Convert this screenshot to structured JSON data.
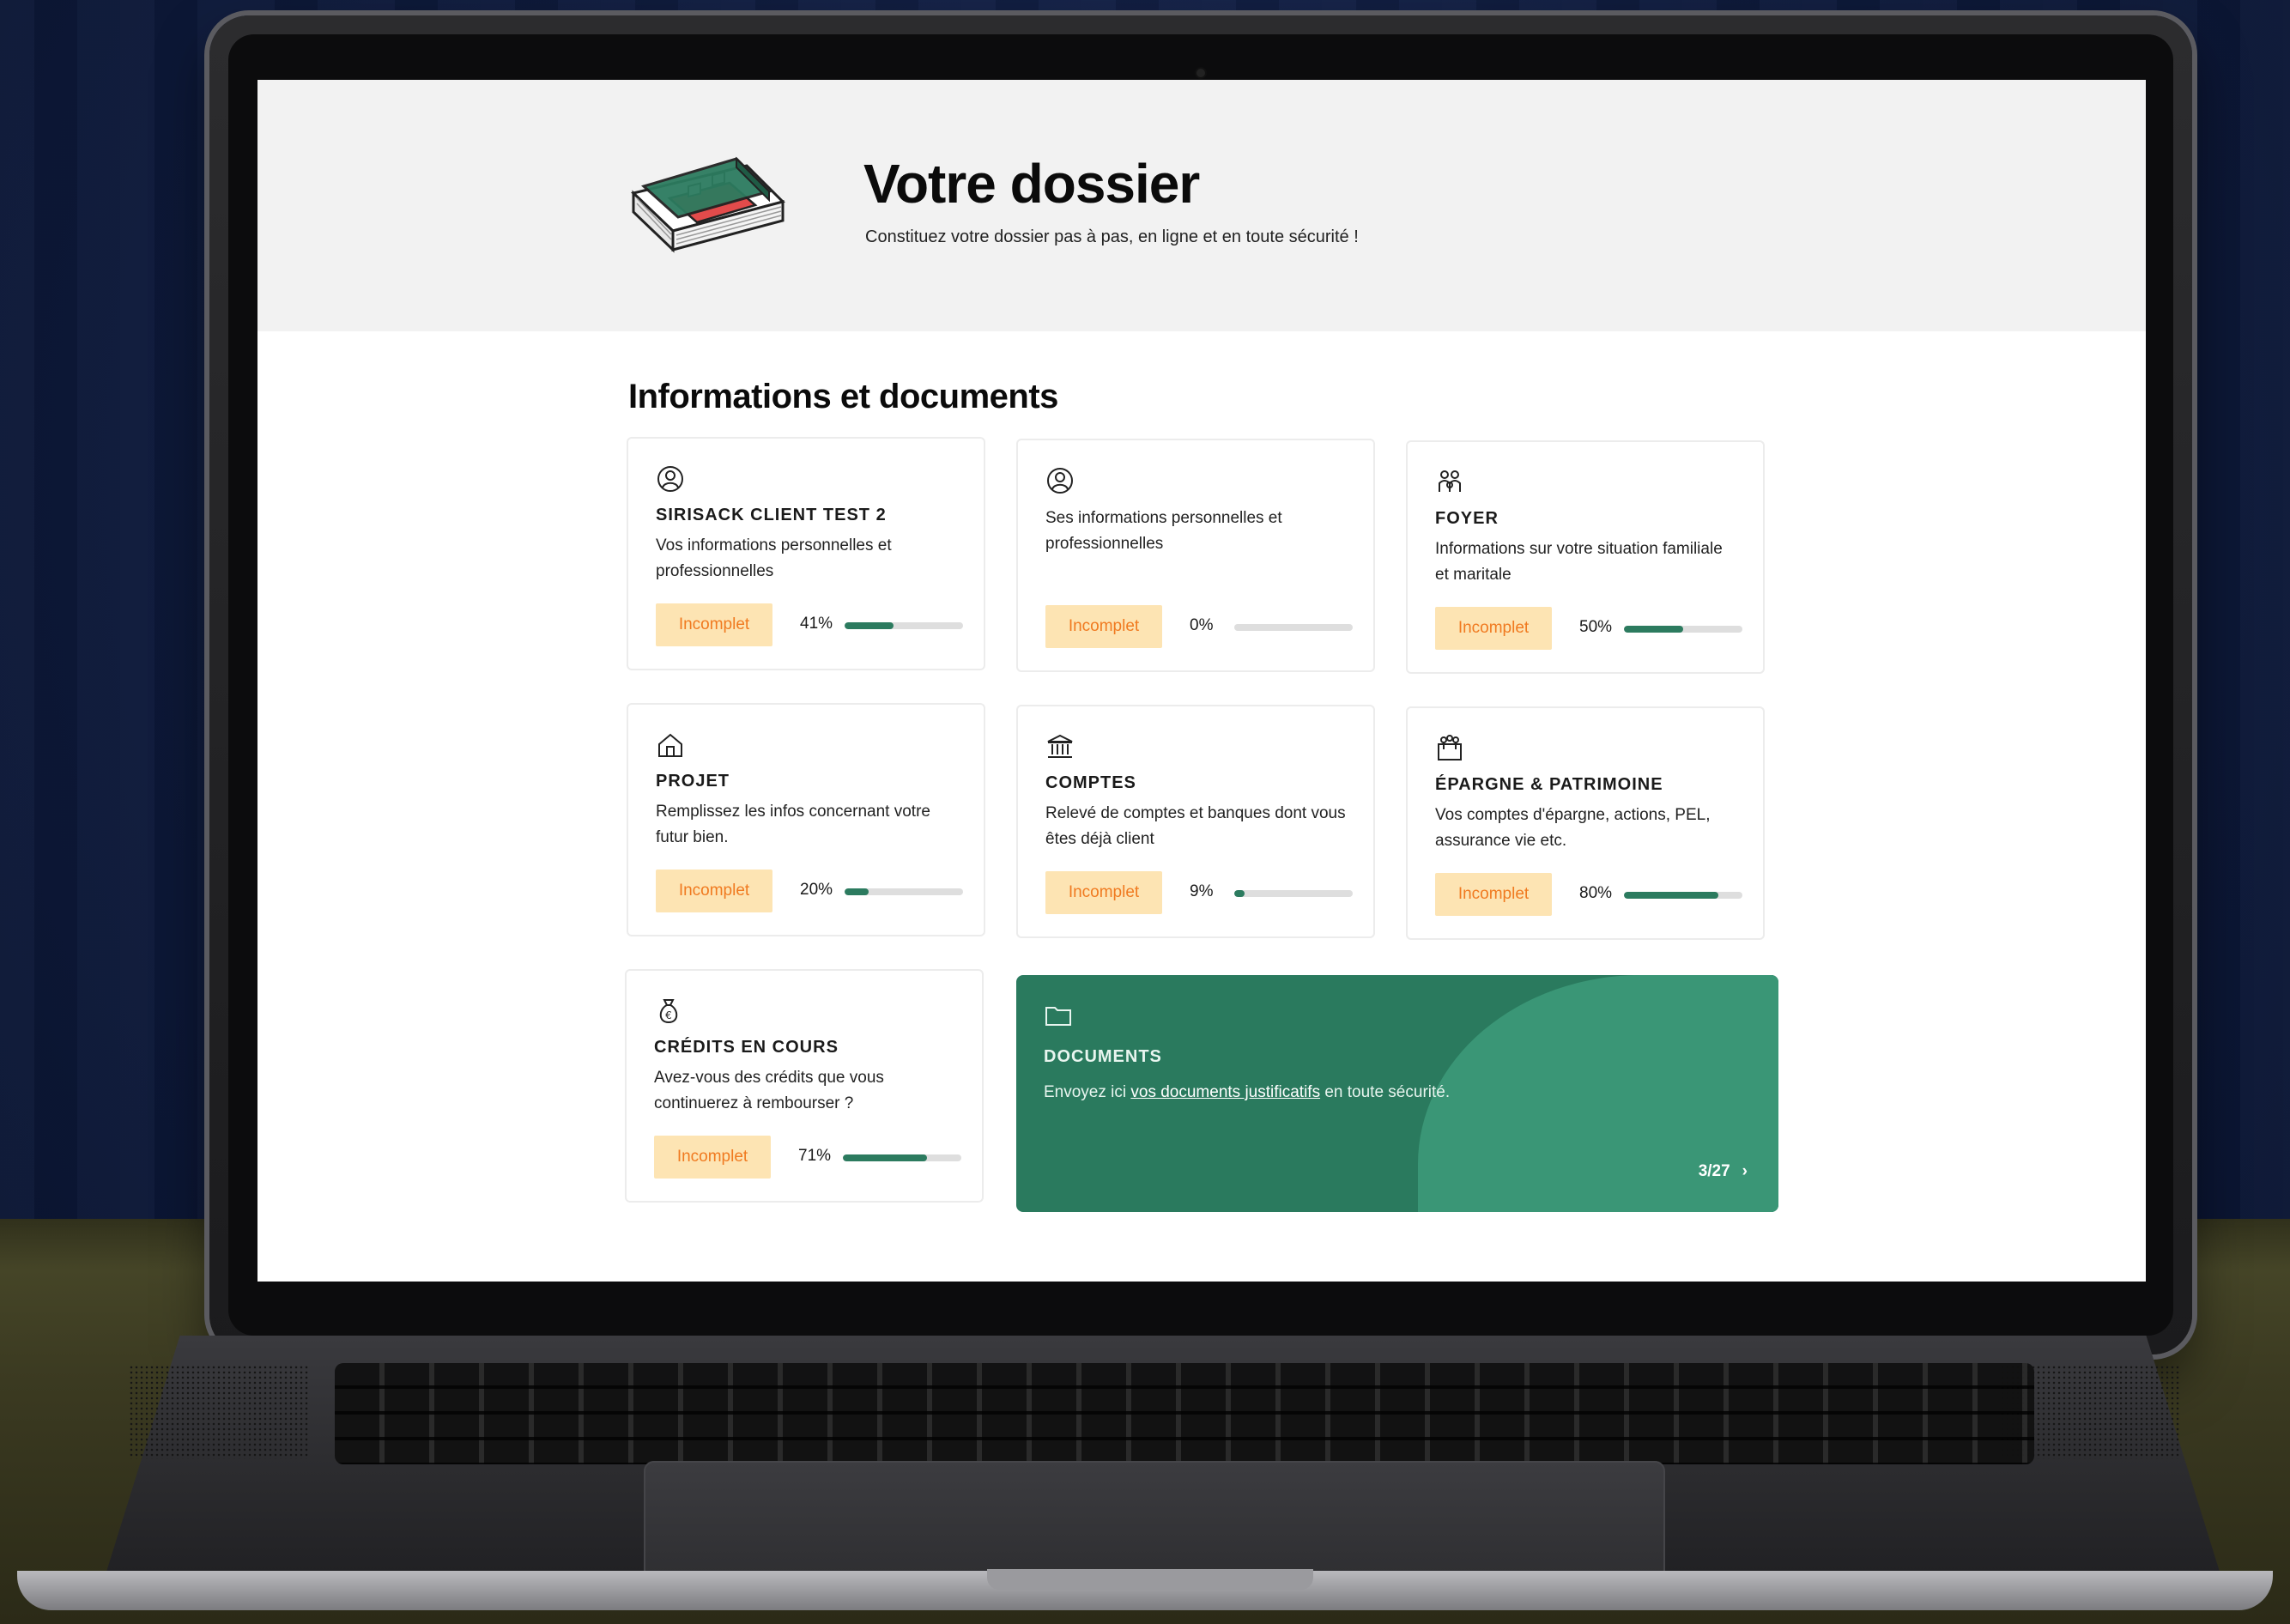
{
  "header": {
    "title": "Votre dossier",
    "subtitle": "Constituez votre dossier pas à pas, en ligne et en toute sécurité !",
    "logo_icon": "house-book-icon"
  },
  "section": {
    "title": "Informations et documents"
  },
  "colors": {
    "accent": "#2c7b5f",
    "badge_bg": "#fde4b3",
    "badge_text": "#f07a20",
    "docs_bg": "#2a7a5e"
  },
  "cards": [
    {
      "icon": "user-circle-icon",
      "title": "SIRISACK CLIENT TEST 2",
      "desc": "Vos informations personnelles et professionnelles",
      "status": "Incomplet",
      "progress_label": "41%",
      "progress": 0.41
    },
    {
      "icon": "user-circle-icon",
      "title": "",
      "desc": "Ses informations personnelles et professionnelles",
      "status": "Incomplet",
      "progress_label": "0%",
      "progress": 0
    },
    {
      "icon": "family-icon",
      "title": "FOYER",
      "desc": "Informations sur votre situation familiale et maritale",
      "status": "Incomplet",
      "progress_label": "50%",
      "progress": 0.5
    },
    {
      "icon": "home-icon",
      "title": "PROJET",
      "desc": "Remplissez les infos concernant votre futur bien.",
      "status": "Incomplet",
      "progress_label": "20%",
      "progress": 0.2
    },
    {
      "icon": "bank-icon",
      "title": "COMPTES",
      "desc": "Relevé de comptes et banques dont vous êtes déjà client",
      "status": "Incomplet",
      "progress_label": "9%",
      "progress": 0.09
    },
    {
      "icon": "savings-icon",
      "title": "ÉPARGNE & PATRIMOINE",
      "desc": "Vos comptes d'épargne, actions, PEL, assurance vie etc.",
      "status": "Incomplet",
      "progress_label": "80%",
      "progress": 0.8
    },
    {
      "icon": "euro-bag-icon",
      "title": "CRÉDITS EN COURS",
      "desc": "Avez-vous des crédits que vous continuerez à rembourser ?",
      "status": "Incomplet",
      "progress_label": "71%",
      "progress": 0.71
    }
  ],
  "documents": {
    "icon": "folder-icon",
    "title": "DOCUMENTS",
    "desc_before": "Envoyez ici ",
    "link": "vos documents justificatifs",
    "desc_after": " en toute sécurité.",
    "pager": "3/27",
    "pager_icon": "chevron-right-icon"
  }
}
